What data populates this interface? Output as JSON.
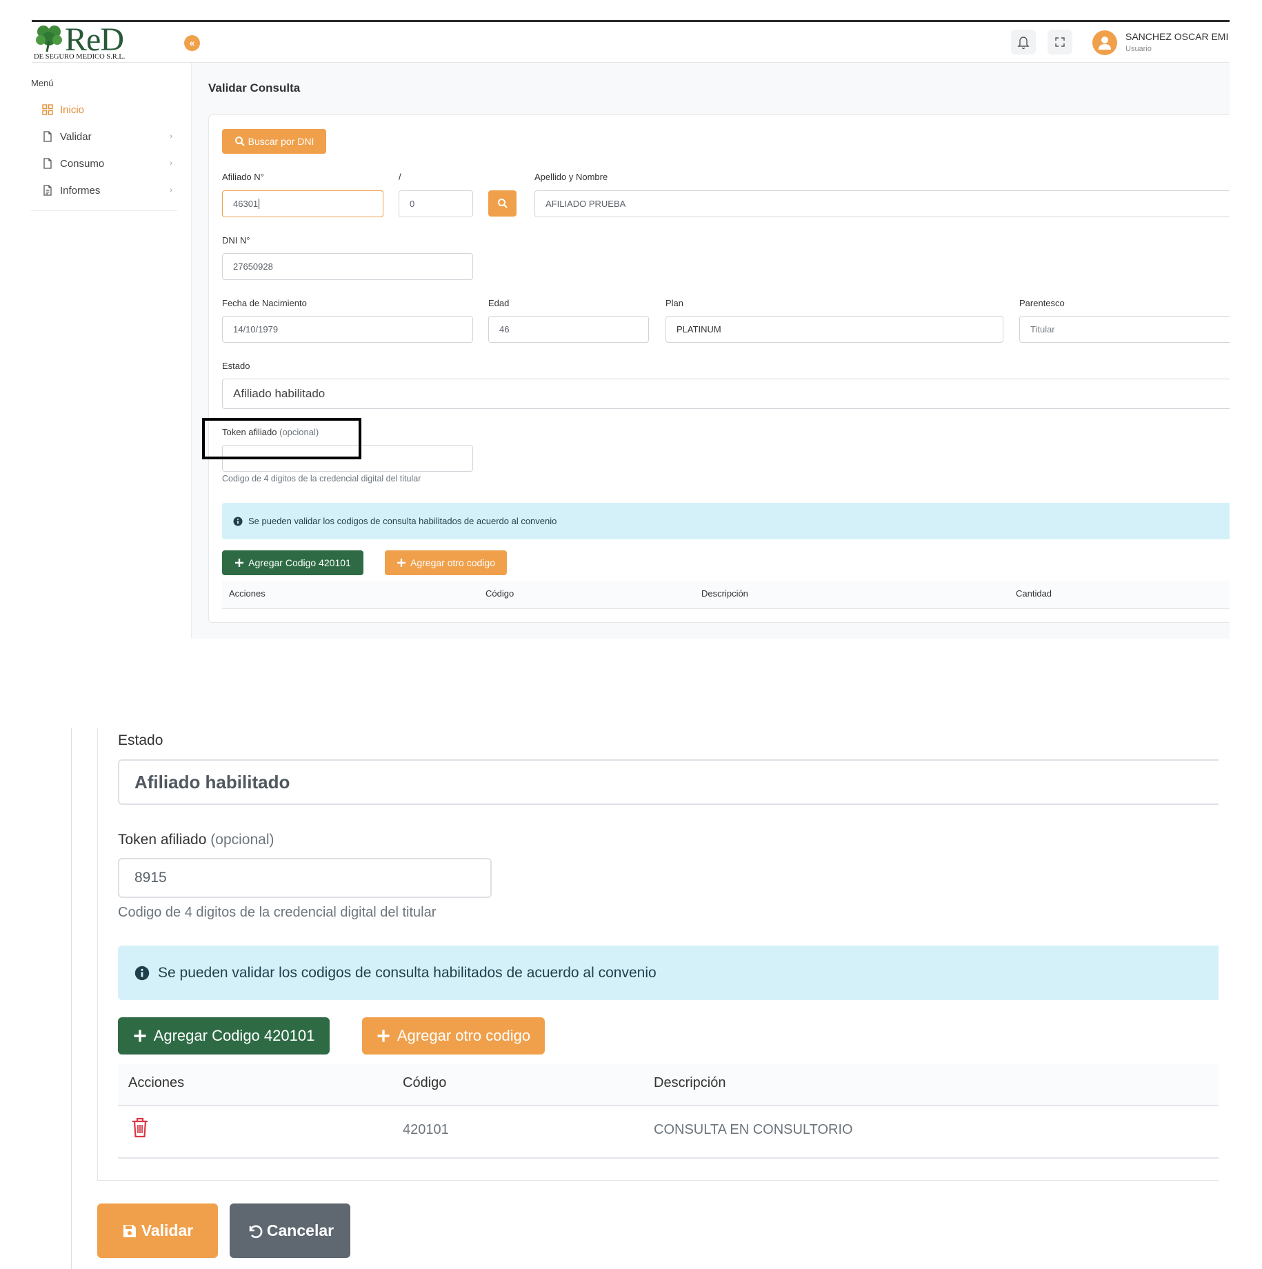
{
  "app": {
    "logo_text": "ReD",
    "logo_subtitle": "DE SEGURO MEDICO S.R.L.",
    "collapse_glyph": "«",
    "user_name": "SANCHEZ OSCAR EMI",
    "user_role": "Usuario"
  },
  "sidebar": {
    "menu_title": "Menú",
    "items": [
      {
        "label": "Inicio",
        "icon": "grid-icon",
        "active": true
      },
      {
        "label": "Validar",
        "icon": "file-icon"
      },
      {
        "label": "Consumo",
        "icon": "file-icon"
      },
      {
        "label": "Informes",
        "icon": "file-text-icon"
      }
    ]
  },
  "page": {
    "title": "Validar Consulta",
    "search_dni_button": "Buscar por DNI",
    "fields": {
      "afiliado_label": "Afiliado N°",
      "afiliado_value": "46301",
      "slash_label": "/",
      "slash_value": "0",
      "apellido_label": "Apellido y Nombre",
      "apellido_value": "AFILIADO PRUEBA",
      "dni_label": "DNI N°",
      "dni_value": "27650928",
      "fecha_label": "Fecha de Nacimiento",
      "fecha_value": "14/10/1979",
      "edad_label": "Edad",
      "edad_value": "46",
      "plan_label": "Plan",
      "plan_value": "PLATINUM",
      "parentesco_label": "Parentesco",
      "parentesco_value": "Titular",
      "estado_label": "Estado",
      "estado_value": "Afiliado habilitado",
      "token_label": "Token afiliado",
      "token_optional": "(opcional)",
      "token_value_top": "",
      "token_value_bottom": "8915",
      "token_hint": "Codigo de 4 digitos de la credencial digital del titular"
    },
    "alert": "Se pueden validar los codigos de consulta habilitados de acuerdo al convenio",
    "add_code_button": "Agregar Codigo 420101",
    "add_other_button": "Agregar otro codigo",
    "table": {
      "headers": [
        "Acciones",
        "Código",
        "Descripción",
        "Cantidad"
      ],
      "rows": [
        {
          "codigo": "420101",
          "descripcion": "CONSULTA EN CONSULTORIO"
        }
      ]
    },
    "validar_button": "Validar",
    "cancelar_button": "Cancelar"
  },
  "colors": {
    "accent_orange": "#f0a04b",
    "green": "#2e6b45",
    "alert_bg": "#d4f1f9",
    "danger": "#dc3545",
    "gray_button": "#5f6871"
  }
}
